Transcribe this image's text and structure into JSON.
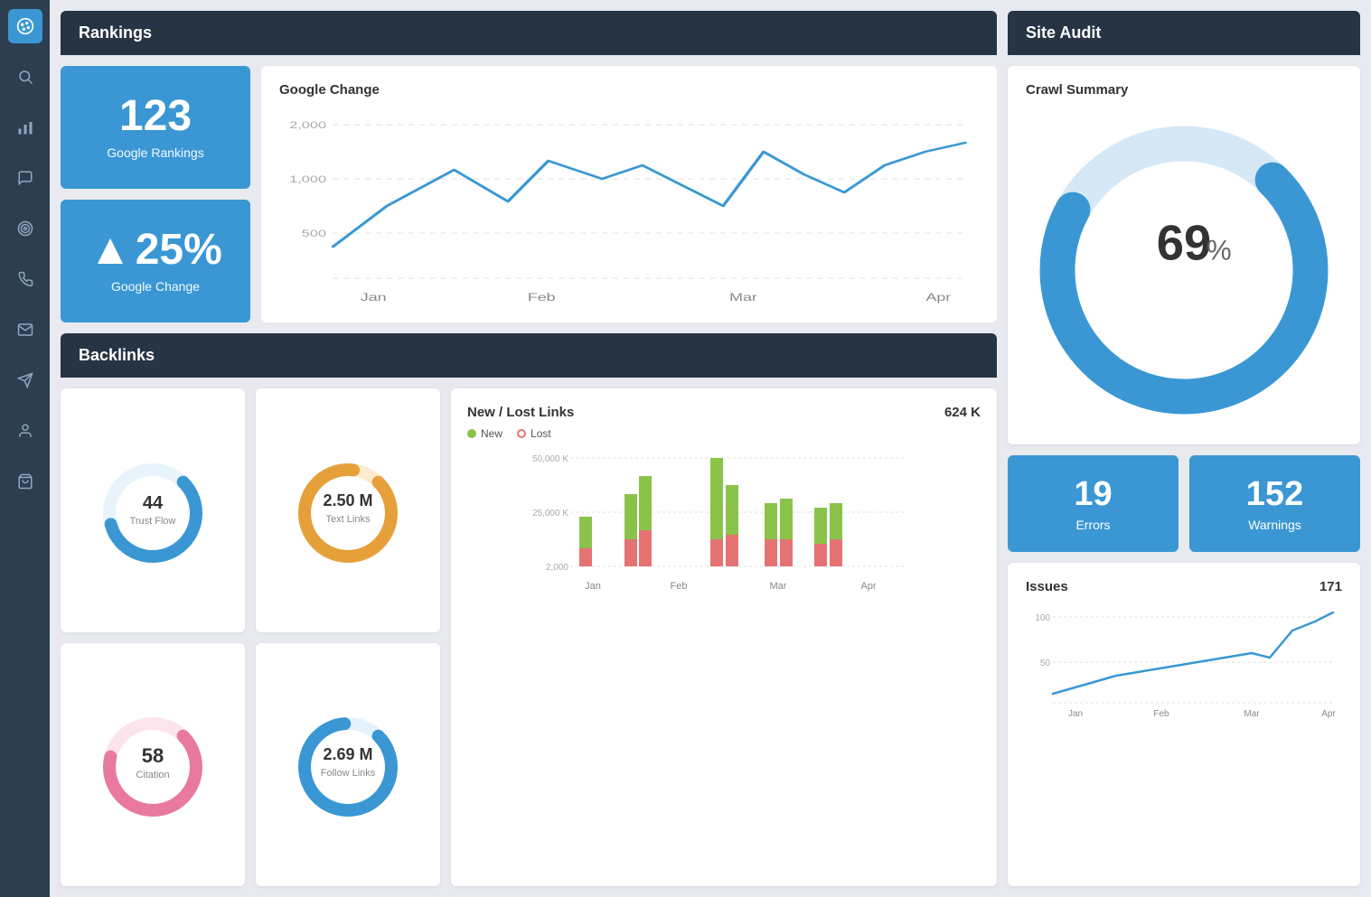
{
  "sidebar": {
    "icons": [
      {
        "name": "palette-icon",
        "symbol": "🎨",
        "active": true
      },
      {
        "name": "search-icon",
        "symbol": "🔍",
        "active": false
      },
      {
        "name": "bar-chart-icon",
        "symbol": "📊",
        "active": false
      },
      {
        "name": "chat-icon",
        "symbol": "💬",
        "active": false
      },
      {
        "name": "target-icon",
        "symbol": "🎯",
        "active": false
      },
      {
        "name": "phone-icon",
        "symbol": "📞",
        "active": false
      },
      {
        "name": "mail-icon",
        "symbol": "✉",
        "active": false
      },
      {
        "name": "send-icon",
        "symbol": "✈",
        "active": false
      },
      {
        "name": "user-icon",
        "symbol": "👤",
        "active": false
      },
      {
        "name": "bag-icon",
        "symbol": "🛍",
        "active": false
      }
    ]
  },
  "rankings": {
    "title": "Rankings",
    "google_rankings_num": "123",
    "google_rankings_label": "Google Rankings",
    "google_change_num": "25%",
    "google_change_label": "Google Change",
    "chart_title": "Google Change",
    "chart_x_labels": [
      "Jan",
      "Feb",
      "Mar",
      "Apr"
    ],
    "chart_y_labels": [
      "2,000",
      "1,000",
      "500"
    ],
    "colors": {
      "accent": "#3a97d4"
    }
  },
  "backlinks": {
    "title": "Backlinks",
    "trust_flow_value": "44",
    "trust_flow_label": "Trust Flow",
    "text_links_value": "2.50 M",
    "text_links_label": "Text Links",
    "citation_value": "58",
    "citation_label": "Citation",
    "follow_links_value": "2.69 M",
    "follow_links_label": "Follow Links",
    "new_lost_title": "New / Lost Links",
    "new_lost_count": "624 K",
    "legend_new": "New",
    "legend_lost": "Lost",
    "chart_x_labels": [
      "Jan",
      "Feb",
      "Mar",
      "Apr"
    ],
    "chart_y_labels": [
      "50,000 K",
      "25,000 K",
      "2,000"
    ]
  },
  "site_audit": {
    "title": "Site Audit",
    "crawl_title": "Crawl Summary",
    "crawl_percent": "69%",
    "errors_num": "19",
    "errors_label": "Errors",
    "warnings_num": "152",
    "warnings_label": "Warnings",
    "issues_title": "Issues",
    "issues_count": "171",
    "issues_x_labels": [
      "Jan",
      "Feb",
      "Mar",
      "Apr"
    ],
    "issues_y_labels": [
      "100",
      "50"
    ]
  }
}
